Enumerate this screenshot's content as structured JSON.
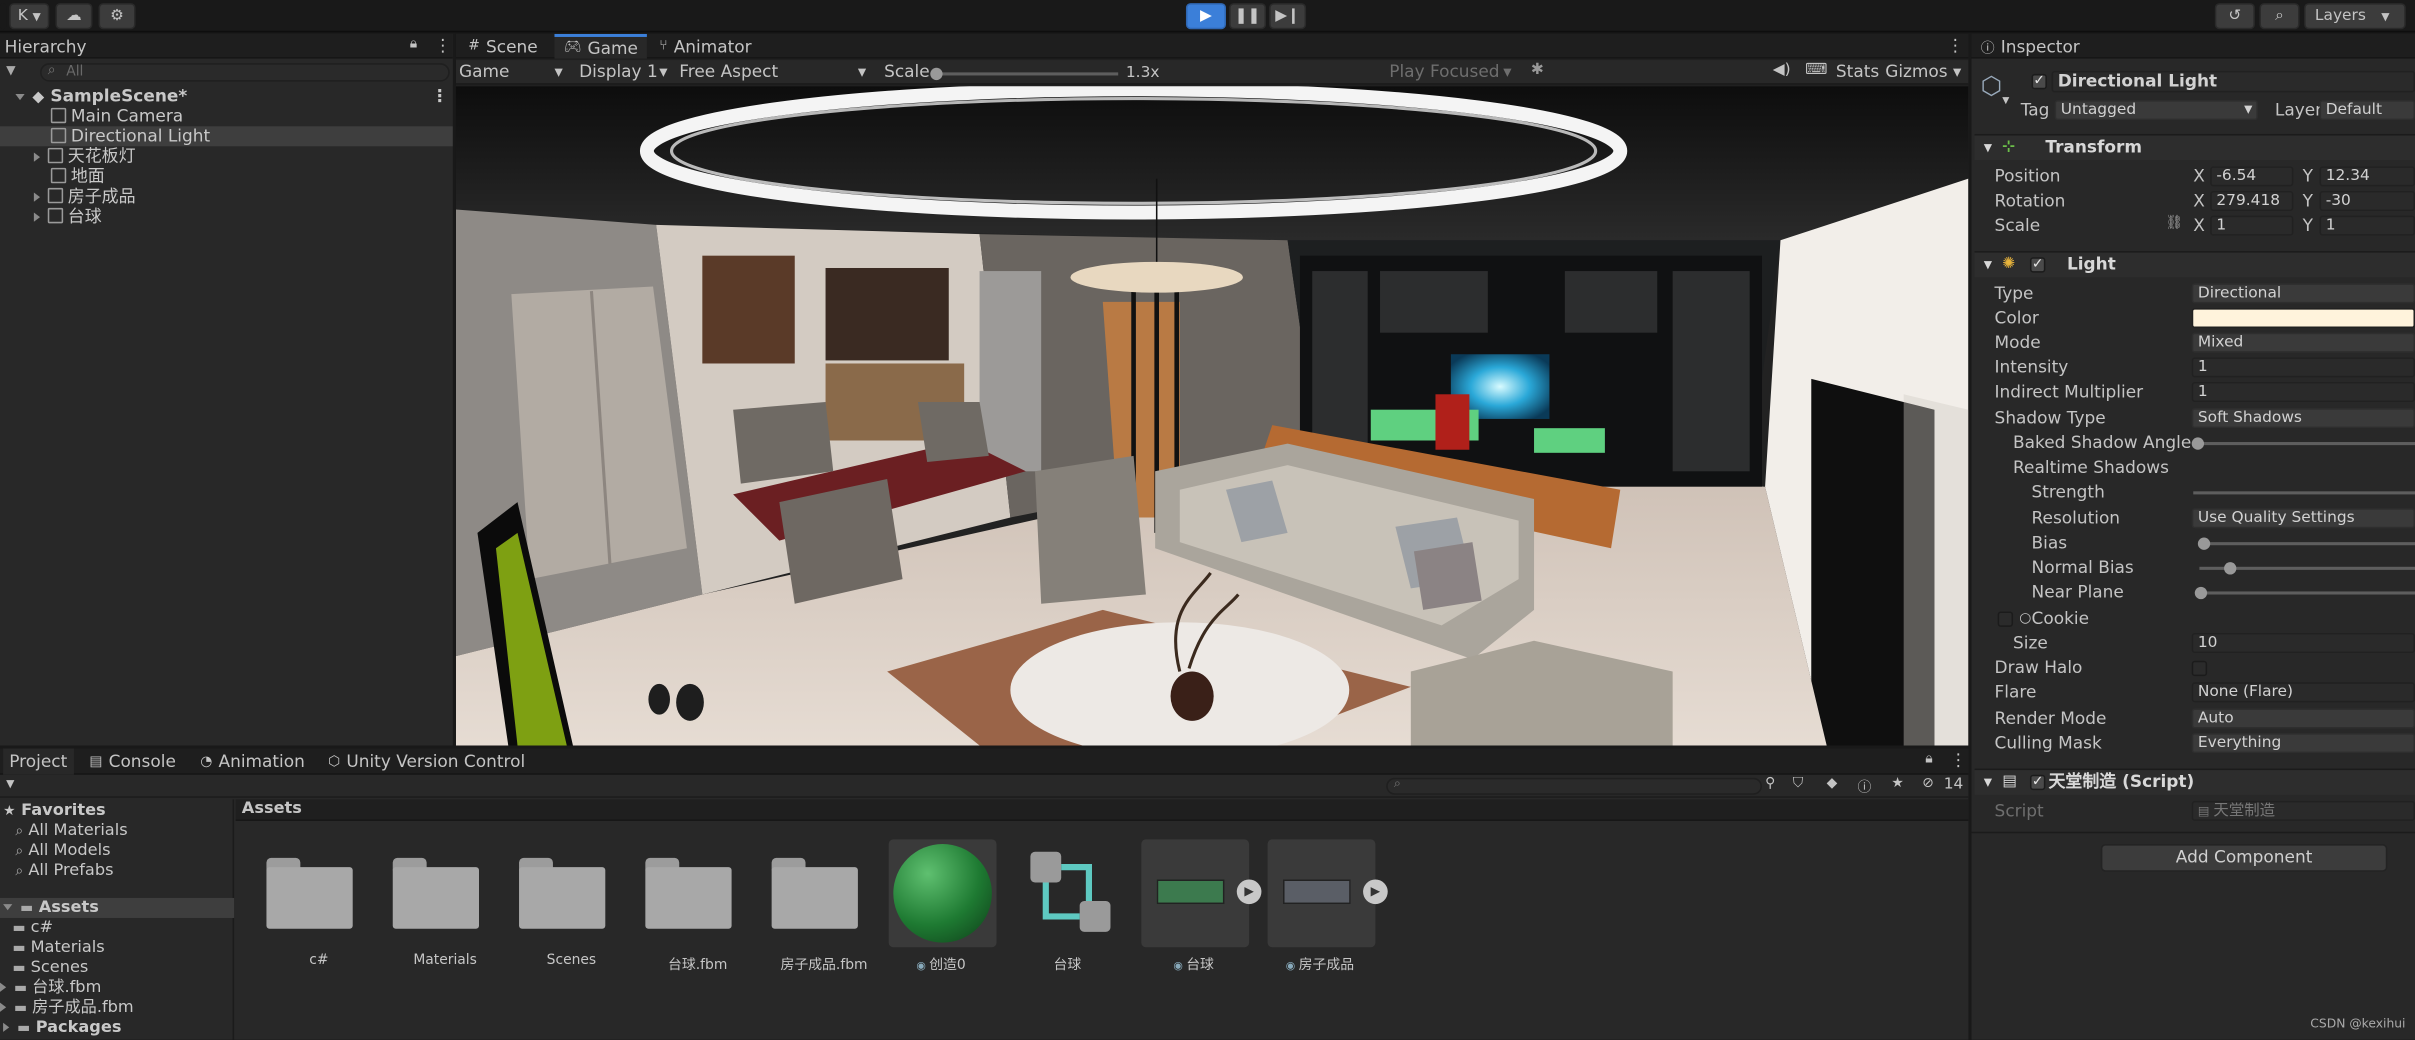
{
  "toolbar": {
    "account_label": "K",
    "layers_label": "Layers"
  },
  "hierarchy": {
    "tab_label": "Hierarchy",
    "search_placeholder": "All",
    "scene_name": "SampleScene*",
    "items": [
      {
        "label": "Main Camera",
        "expandable": false,
        "selected": false
      },
      {
        "label": "Directional Light",
        "expandable": false,
        "selected": true
      },
      {
        "label": "天花板灯",
        "expandable": true,
        "selected": false
      },
      {
        "label": "地面",
        "expandable": false,
        "selected": false
      },
      {
        "label": "房子成品",
        "expandable": true,
        "selected": false
      },
      {
        "label": "台球",
        "expandable": true,
        "selected": false
      }
    ]
  },
  "view_tabs": {
    "scene": "Scene",
    "game": "Game",
    "animator": "Animator"
  },
  "game_bar": {
    "mode": "Game",
    "display": "Display 1",
    "aspect": "Free Aspect",
    "scale_label": "Scale",
    "scale_value": "1.3x",
    "scale_fraction": 0.0,
    "play_focused": "Play Focused",
    "stats": "Stats",
    "gizmos": "Gizmos"
  },
  "inspector": {
    "tab_label": "Inspector",
    "object_name": "Directional Light",
    "tag_label": "Tag",
    "tag_value": "Untagged",
    "layer_label": "Layer",
    "layer_value": "Default",
    "transform": {
      "title": "Transform",
      "position_label": "Position",
      "rotation_label": "Rotation",
      "scale_label": "Scale",
      "x": "X",
      "y": "Y",
      "position_x": "-6.54",
      "position_y": "12.34",
      "rotation_x": "279.418",
      "rotation_y": "-30",
      "scale_x": "1",
      "scale_y": "1"
    },
    "light": {
      "title": "Light",
      "props": [
        {
          "label": "Type",
          "value": "Directional",
          "kind": "dropdown"
        },
        {
          "label": "Color",
          "value": "",
          "kind": "color"
        },
        {
          "label": "Mode",
          "value": "Mixed",
          "kind": "dropdown"
        },
        {
          "label": "Intensity",
          "value": "1",
          "kind": "field"
        },
        {
          "label": "Indirect Multiplier",
          "value": "1",
          "kind": "field"
        },
        {
          "label": "Shadow Type",
          "value": "Soft Shadows",
          "kind": "dropdown"
        }
      ],
      "baked_shadow_angle": "Baked Shadow Angle",
      "realtime_shadows": "Realtime Shadows",
      "strength": "Strength",
      "resolution": "Resolution",
      "resolution_value": "Use Quality Settings",
      "bias": "Bias",
      "normal_bias": "Normal Bias",
      "near_plane": "Near Plane",
      "cookie": "Cookie",
      "size": "Size",
      "size_value": "10",
      "draw_halo": "Draw Halo",
      "flare": "Flare",
      "flare_value": "None (Flare)",
      "render_mode": "Render Mode",
      "render_mode_value": "Auto",
      "culling_mask": "Culling Mask",
      "culling_mask_value": "Everything",
      "color_hex": "#fff3dc"
    },
    "script_component": {
      "title": "天堂制造 (Script)",
      "script_label": "Script",
      "script_value": "天堂制造"
    },
    "add_component": "Add Component"
  },
  "bottom_tabs": {
    "project": "Project",
    "console": "Console",
    "animation": "Animation",
    "version_control": "Unity Version Control",
    "hidden_count": "14"
  },
  "project": {
    "favorites_label": "Favorites",
    "favorites": [
      "All Materials",
      "All Models",
      "All Prefabs"
    ],
    "assets_label": "Assets",
    "asset_folders": [
      "c#",
      "Materials",
      "Scenes",
      "台球.fbm",
      "房子成品.fbm"
    ],
    "packages_label": "Packages",
    "breadcrumb": "Assets",
    "grid_items": [
      {
        "label": "c#",
        "kind": "folder"
      },
      {
        "label": "Materials",
        "kind": "folder"
      },
      {
        "label": "Scenes",
        "kind": "folder"
      },
      {
        "label": "台球.fbm",
        "kind": "folder"
      },
      {
        "label": "房子成品.fbm",
        "kind": "folder"
      },
      {
        "label": "创造0",
        "kind": "material"
      },
      {
        "label": "台球",
        "kind": "prefab-variant"
      },
      {
        "label": "台球",
        "kind": "model"
      },
      {
        "label": "房子成品",
        "kind": "model"
      }
    ]
  },
  "watermark": "CSDN @kexihui",
  "colors": {
    "accent_play": "#3b7fd9",
    "selection": "#2c5d87"
  }
}
